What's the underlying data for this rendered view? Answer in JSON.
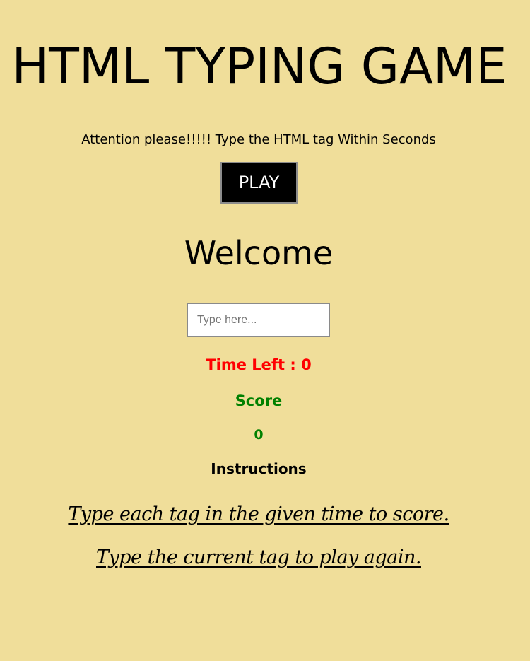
{
  "game": {
    "title": "HTML TYPING GAME",
    "subtitle": "Attention please!!!!! Type the HTML tag Within Seconds",
    "play_label": "PLAY",
    "current_word": "Welcome",
    "input": {
      "value": "",
      "placeholder": "Type here..."
    },
    "time_left_text": "Time Left : 0",
    "score_label": "Score",
    "score_value": "0",
    "instructions": {
      "heading": "Instructions",
      "items": [
        "Type each tag in the given time to score.",
        "Type the current tag to play again."
      ]
    }
  },
  "colors": {
    "background": "#f0de9a",
    "time_left": "#ff0000",
    "score": "#008000",
    "button_bg": "#000000",
    "button_text": "#ffffff"
  }
}
